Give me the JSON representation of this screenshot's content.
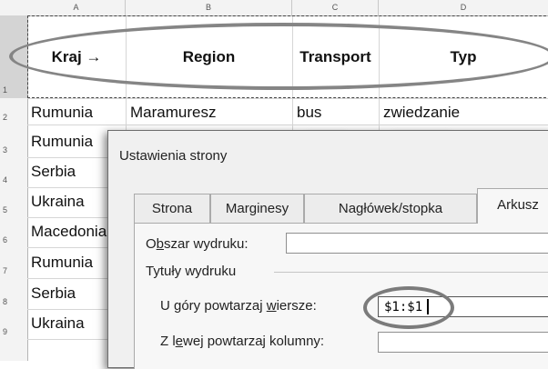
{
  "column_headers": [
    "A",
    "B",
    "C",
    "D"
  ],
  "row_numbers": [
    "1",
    "2",
    "3",
    "4",
    "5",
    "6",
    "7",
    "8",
    "9"
  ],
  "header_row": {
    "kraj": "Kraj →",
    "region": "Region",
    "transport": "Transport",
    "typ": "Typ"
  },
  "row2": {
    "kraj": "Rumunia",
    "region": "Maramuresz",
    "transport": "bus",
    "typ": "zwiedzanie"
  },
  "kraj_column": [
    "Rumunia",
    "Serbia",
    "Ukraina",
    "Macedonia",
    "Rumunia",
    "Serbia",
    "Ukraina"
  ],
  "dialog": {
    "title": "Ustawienia strony",
    "tabs": [
      "Strona",
      "Marginesy",
      "Nagłówek/stopka",
      "Arkusz"
    ],
    "active_tab": "Arkusz",
    "print_area_label_pre": "O",
    "print_area_label_u": "b",
    "print_area_label_post": "szar wydruku:",
    "print_area_value": "",
    "print_titles_group": "Tytuły wydruku",
    "rows_label_pre": "U góry powtarzaj ",
    "rows_label_u": "w",
    "rows_label_post": "iersze:",
    "rows_value": "$1:$1",
    "cols_label_pre": "Z l",
    "cols_label_u": "e",
    "cols_label_post": "wej powtarzaj kolumny:",
    "cols_value": ""
  },
  "colors": {
    "highlight_ellipse": "#858585",
    "dialog_bg": "#f0f0f0",
    "row_header_selected": "#d4d4d4"
  }
}
